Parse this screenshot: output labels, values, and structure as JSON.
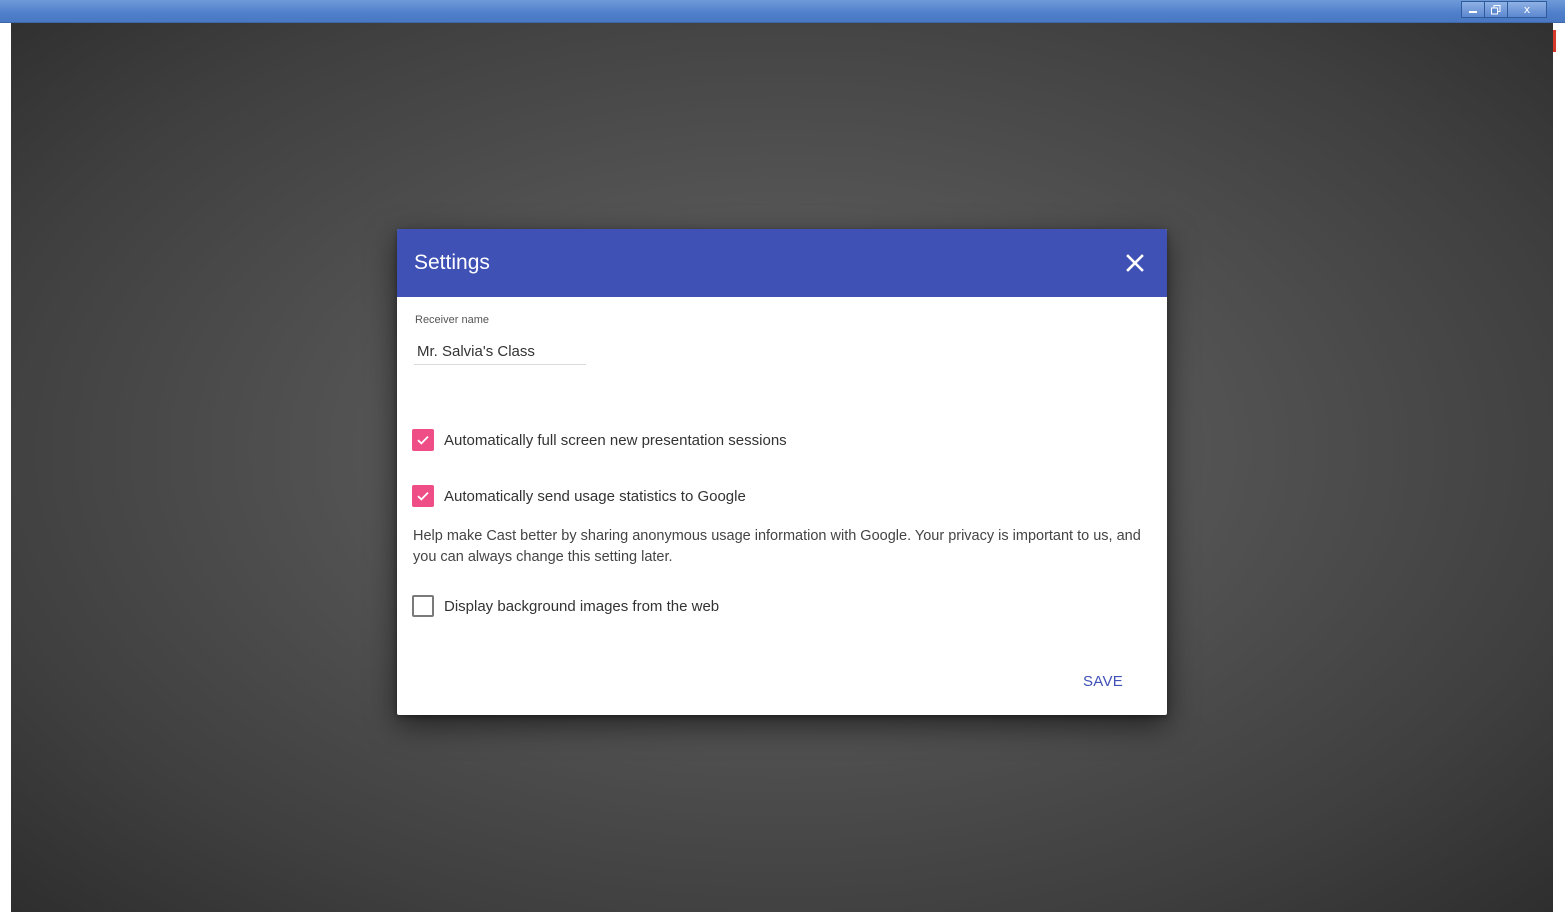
{
  "window": {
    "minimize_glyph": "",
    "restore_glyph": "",
    "close_glyph": "x"
  },
  "dialog": {
    "title": "Settings",
    "close_icon": "close-icon",
    "receiver_label": "Receiver name",
    "receiver_value": "Mr. Salvia's Class",
    "options": [
      {
        "label": "Automatically full screen new presentation sessions",
        "checked": true
      },
      {
        "label": "Automatically send usage statistics to Google",
        "checked": true
      },
      {
        "label": "Display background images from the web",
        "checked": false
      }
    ],
    "help_text": "Help make Cast better by sharing anonymous usage information with Google. Your privacy is important to us, and you can always change this setting later.",
    "save_label": "SAVE"
  },
  "colors": {
    "header": "#3f51b5",
    "checkbox_checked": "#ee4d85",
    "accent_text": "#3f51b5"
  }
}
